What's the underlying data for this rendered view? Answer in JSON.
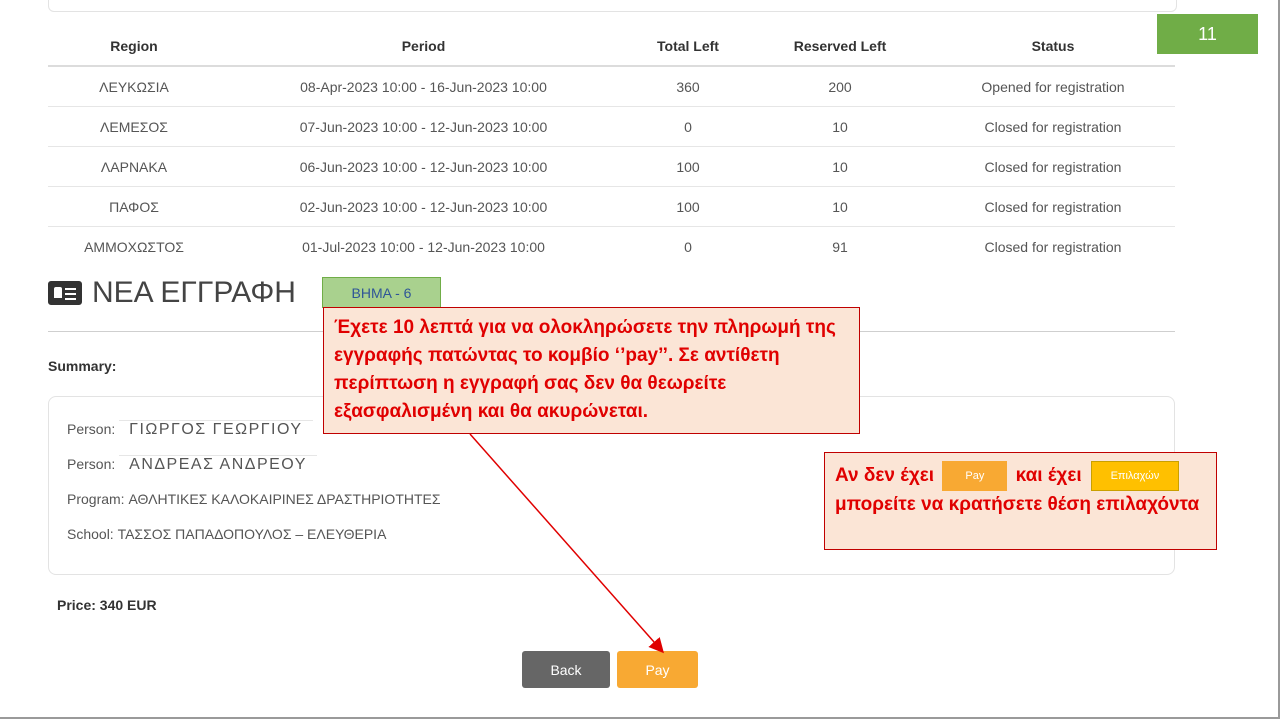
{
  "page_number": "11",
  "table": {
    "headers": [
      "Region",
      "Period",
      "Total Left",
      "Reserved Left",
      "Status"
    ],
    "rows": [
      [
        "ΛΕΥΚΩΣΙΑ",
        "08-Apr-2023 10:00 - 16-Jun-2023 10:00",
        "360",
        "200",
        "Opened for registration"
      ],
      [
        "ΛΕΜΕΣΟΣ",
        "07-Jun-2023 10:00 - 12-Jun-2023 10:00",
        "0",
        "10",
        "Closed for registration"
      ],
      [
        "ΛΑΡΝΑΚΑ",
        "06-Jun-2023 10:00 - 12-Jun-2023 10:00",
        "100",
        "10",
        "Closed for registration"
      ],
      [
        "ΠΑΦΟΣ",
        "02-Jun-2023 10:00 - 12-Jun-2023 10:00",
        "100",
        "10",
        "Closed for registration"
      ],
      [
        "ΑΜΜΟΧΩΣΤΟΣ",
        "01-Jul-2023 10:00 - 12-Jun-2023 10:00",
        "0",
        "91",
        "Closed for registration"
      ]
    ]
  },
  "section": {
    "title": "ΝΕΑ ΕΓΓΡΑΦΗ",
    "step_badge": "ΒΗΜΑ - 6"
  },
  "summary": {
    "label": "Summary:",
    "person_label": "Person:",
    "persons": [
      "ΓΙΩΡΓΟΣ ΓΕΩΡΓΙΟΥ",
      "ΑΝΔΡΕΑΣ ΑΝΔΡΕΟΥ"
    ],
    "program": "Program: ΑΘΛΗΤΙΚΕΣ ΚΑΛΟΚΑΙΡΙΝΕΣ ΔΡΑΣΤΗΡΙΟΤΗΤΕΣ",
    "school": "School: ΤΑΣΣΟΣ ΠΑΠΑΔΟΠΟΥΛΟΣ – ΕΛΕΥΘΕΡΙΑ"
  },
  "price": "Price: 340 EUR",
  "buttons": {
    "back": "Back",
    "pay": "Pay"
  },
  "callouts": {
    "payment_note": "Έχετε 10 λεπτά για να ολοκληρώσετε την πληρωμή της εγγραφής πατώντας το κομβίο ‘’pay’’. Σε αντίθετη περίπτωση η εγγραφή σας δεν θα θεωρείτε εξασφαλισμένη και θα ακυρώνεται.",
    "waitlist_part1": "Αν δεν έχει",
    "waitlist_pay": "Pay",
    "waitlist_part2": "και έχει",
    "waitlist_alt": "Επιλαχών",
    "waitlist_part3": "μπορείτε να κρατήσετε θέση επιλαχόντα"
  },
  "colors": {
    "page_number_bg": "#70ad47",
    "step_badge_bg": "#a9d18e",
    "pay_button": "#f8a933",
    "back_button": "#666666",
    "callout_bg": "#fbe5d6",
    "callout_text": "#e00000"
  }
}
